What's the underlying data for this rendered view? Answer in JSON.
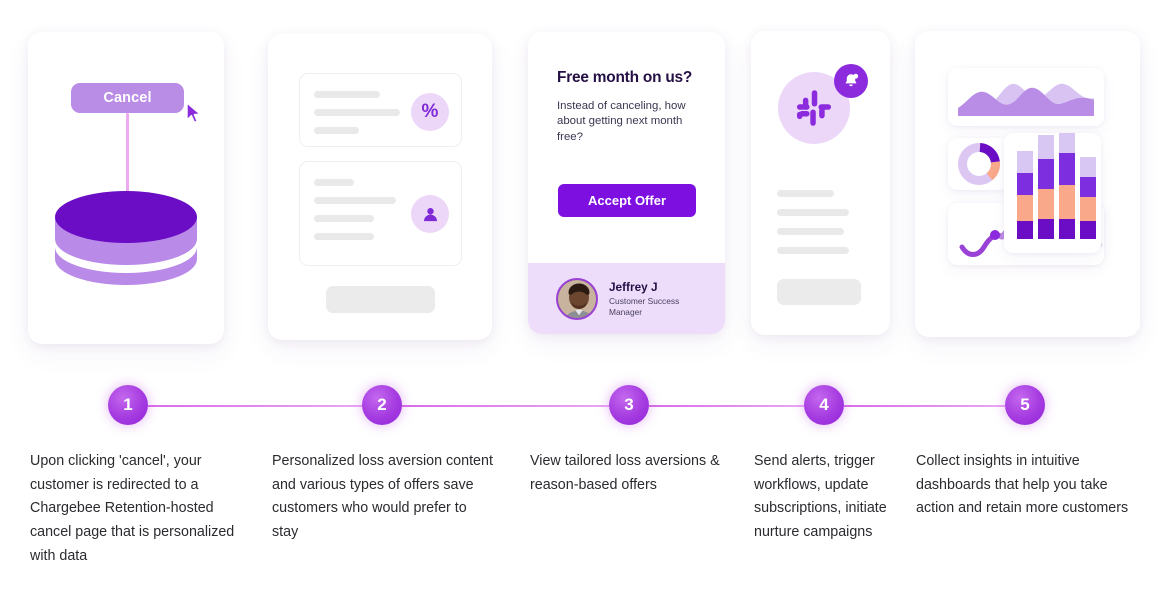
{
  "colors": {
    "brand_purple": "#7d10e0",
    "deep_purple": "#6a0dc4",
    "light_lavender": "#ecd7f9",
    "mid_purple": "#b98de6",
    "pink_line": "#e08ceb",
    "peach": "#f9a98a",
    "heading_ink": "#241045",
    "body_ink": "#2b2b2f",
    "skeleton_gray": "#e9e9ea",
    "page_bg": "#ffffff"
  },
  "cards": {
    "card1": {
      "name": "cancel-flow-illustration",
      "cancel_button_label": "Cancel",
      "cursor_icon": "cursor-arrow-icon",
      "database_icon": "database-cylinder-icon"
    },
    "card2": {
      "name": "offer-content-illustration",
      "sub_card_1": {
        "icon": "percent-icon",
        "icon_label": "%",
        "skeleton_lines": 3
      },
      "sub_card_2": {
        "icon": "person-icon",
        "skeleton_lines": 4
      },
      "footer_button_placeholder": "button-placeholder"
    },
    "card3": {
      "name": "offer-modal",
      "heading": "Free month on us?",
      "body": "Instead of canceling, how about getting next month free?",
      "cta_label": "Accept Offer",
      "agent": {
        "avatar": "agent-photo-avatar",
        "name": "Jeffrey J",
        "role_line1": "Customer Success",
        "role_line2": "Manager"
      }
    },
    "card4": {
      "name": "slack-notification-illustration",
      "app_icon": "slack-icon",
      "badge_icon": "bell-notification-icon",
      "skeleton_lines": 4,
      "footer_button_placeholder": "button-placeholder"
    },
    "card5": {
      "name": "analytics-dashboard-illustration",
      "panels": [
        "area-chart-panel",
        "donut-chart-panel",
        "line-chart-panel",
        "bar-chart-panel"
      ]
    }
  },
  "chart_data": [
    {
      "type": "area",
      "title": "",
      "id": "area-chart-panel",
      "series": [
        {
          "name": "front-wave",
          "values": [
            22,
            34,
            26,
            46,
            30,
            50,
            28,
            38,
            24,
            40,
            30
          ]
        },
        {
          "name": "back-wave",
          "values": [
            14,
            26,
            40,
            22,
            44,
            36,
            52,
            26,
            38,
            22,
            34
          ]
        }
      ],
      "x": [
        0,
        1,
        2,
        3,
        4,
        5,
        6,
        7,
        8,
        9,
        10
      ],
      "ylim": [
        0,
        58
      ],
      "grid": false,
      "legend": "none"
    },
    {
      "type": "pie",
      "id": "donut-chart-panel",
      "title": "",
      "labels": [
        "segment-a",
        "segment-b",
        "segment-c"
      ],
      "values": [
        62,
        22,
        16
      ],
      "colors": [
        "#dcc6f2",
        "#6a0dc4",
        "#f9a98a"
      ],
      "legend": "none"
    },
    {
      "type": "bar",
      "id": "bar-chart-panel",
      "title": "",
      "stacked": true,
      "categories": [
        "1",
        "2",
        "3",
        "4"
      ],
      "series": [
        {
          "name": "dark-purple",
          "values": [
            18,
            20,
            20,
            18
          ],
          "color": "#6a0dc4"
        },
        {
          "name": "peach",
          "values": [
            26,
            30,
            34,
            24
          ],
          "color": "#f9a98a"
        },
        {
          "name": "mid-purple",
          "values": [
            22,
            30,
            32,
            20
          ],
          "color": "#7d2fe0"
        },
        {
          "name": "lavender",
          "values": [
            22,
            24,
            26,
            20
          ],
          "color": "#d9c7f3"
        }
      ],
      "ylim": [
        0,
        112
      ],
      "grid": false,
      "legend": "none"
    },
    {
      "type": "line",
      "id": "line-chart-panel",
      "title": "",
      "x": [
        0,
        1,
        2,
        3,
        4,
        5,
        6,
        7,
        8
      ],
      "series": [
        {
          "name": "wave",
          "values": [
            28,
            44,
            18,
            40,
            14,
            40,
            16,
            40,
            20
          ]
        }
      ],
      "marker_points": [
        {
          "x": 2,
          "y": 18
        }
      ],
      "ylim": [
        0,
        52
      ],
      "grid": false,
      "legend": "none"
    }
  ],
  "timeline": {
    "steps": [
      {
        "number": "1",
        "caption": "Upon clicking 'cancel', your customer is redirected to a Chargebee Retention-hosted cancel page that is personalized with data"
      },
      {
        "number": "2",
        "caption": "Personalized loss aversion content and various types of offers save customers who would prefer to stay"
      },
      {
        "number": "3",
        "caption": "View tailored loss aversions & reason-based offers"
      },
      {
        "number": "4",
        "caption": "Send alerts, trigger workflows, update subscriptions, initiate nurture campaigns"
      },
      {
        "number": "5",
        "caption": "Collect insights in intuitive dashboards that help you take action and retain more customers"
      }
    ]
  }
}
